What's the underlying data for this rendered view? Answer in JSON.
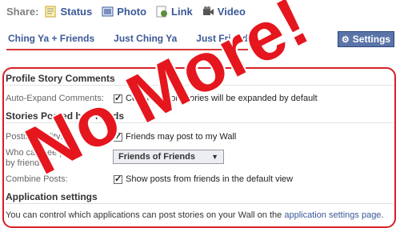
{
  "share": {
    "label": "Share:",
    "items": [
      {
        "label": "Status",
        "icon": "status-icon"
      },
      {
        "label": "Photo",
        "icon": "photo-icon"
      },
      {
        "label": "Link",
        "icon": "link-icon"
      },
      {
        "label": "Video",
        "icon": "video-icon"
      }
    ]
  },
  "tabs": [
    {
      "label": "Ching Ya + Friends"
    },
    {
      "label": "Just Ching Ya"
    },
    {
      "label": "Just Friends"
    }
  ],
  "settings_button": {
    "label": "Settings",
    "icon": "gear-icon"
  },
  "profile_story_comments": {
    "heading": "Profile Story Comments",
    "auto_expand_label": "Auto-Expand Comments:",
    "auto_expand_text": "Comments on stories will be expanded by default",
    "auto_expand_checked": true
  },
  "stories_posted_by_friends": {
    "heading": "Stories Posted by Friends",
    "posting_ability_label": "Posting Ability:",
    "posting_ability_text": "Friends may post to my Wall",
    "posting_ability_checked": true,
    "who_can_see_label_1": "Who can see posts",
    "who_can_see_label_2": "by friends?",
    "who_can_see_value": "Friends of Friends",
    "combine_posts_label": "Combine Posts:",
    "combine_posts_text": "Show posts from friends in the default view",
    "combine_posts_checked": true
  },
  "application_settings": {
    "heading": "Application settings",
    "text": "You can control which applications can post stories on your Wall on the",
    "link": "application settings page",
    "end": "."
  },
  "overlay_text": "No More!",
  "colors": {
    "brand_blue": "#3b5998",
    "overlay_red": "#e5161d",
    "frame_red": "#d61f26"
  }
}
